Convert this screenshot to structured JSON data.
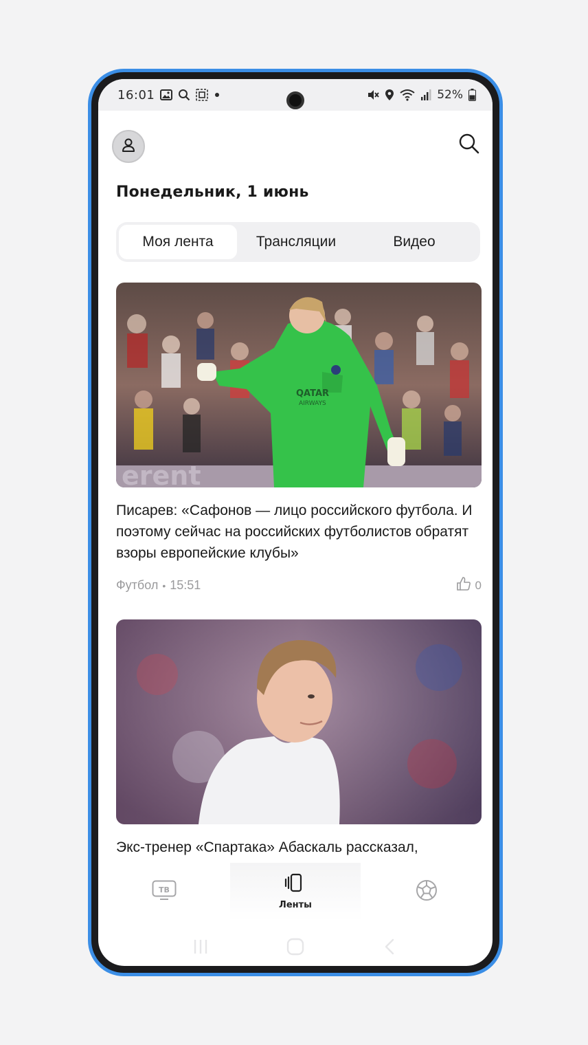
{
  "status_bar": {
    "time": "16:01",
    "battery": "52%",
    "left_icons": [
      "image-icon",
      "search-icon",
      "screenshot-icon",
      "dot-icon"
    ],
    "right_icons": [
      "mute-icon",
      "location-icon",
      "wifi-icon",
      "signal-icon",
      "battery-icon"
    ]
  },
  "header": {
    "date": "Понедельник, 1 июнь"
  },
  "tabs": [
    {
      "label": "Моя лента",
      "active": true
    },
    {
      "label": "Трансляции",
      "active": false
    },
    {
      "label": "Видео",
      "active": false
    }
  ],
  "articles": [
    {
      "title": "Писарев: «Сафонов — лицо российского футбола. И поэтому сейчас на российских футболистов обратят взоры европейские клубы»",
      "category": "Футбол",
      "time": "15:51",
      "likes": "0"
    },
    {
      "title": "Экс-тренер «Спартака» Абаскаль рассказал,",
      "category": "",
      "time": "",
      "likes": ""
    }
  ],
  "bottom_nav": [
    {
      "icon": "tv-icon",
      "label": "",
      "icon_text": "ТВ",
      "active": false
    },
    {
      "icon": "feeds-icon",
      "label": "Ленты",
      "active": true
    },
    {
      "icon": "soccer-ball-icon",
      "label": "",
      "active": false
    }
  ],
  "colors": {
    "frame": "#3b8ee6",
    "accent_text": "#1a1a1a",
    "muted": "#9a9a9c",
    "goalkeeper_kit": "#34c24a"
  }
}
